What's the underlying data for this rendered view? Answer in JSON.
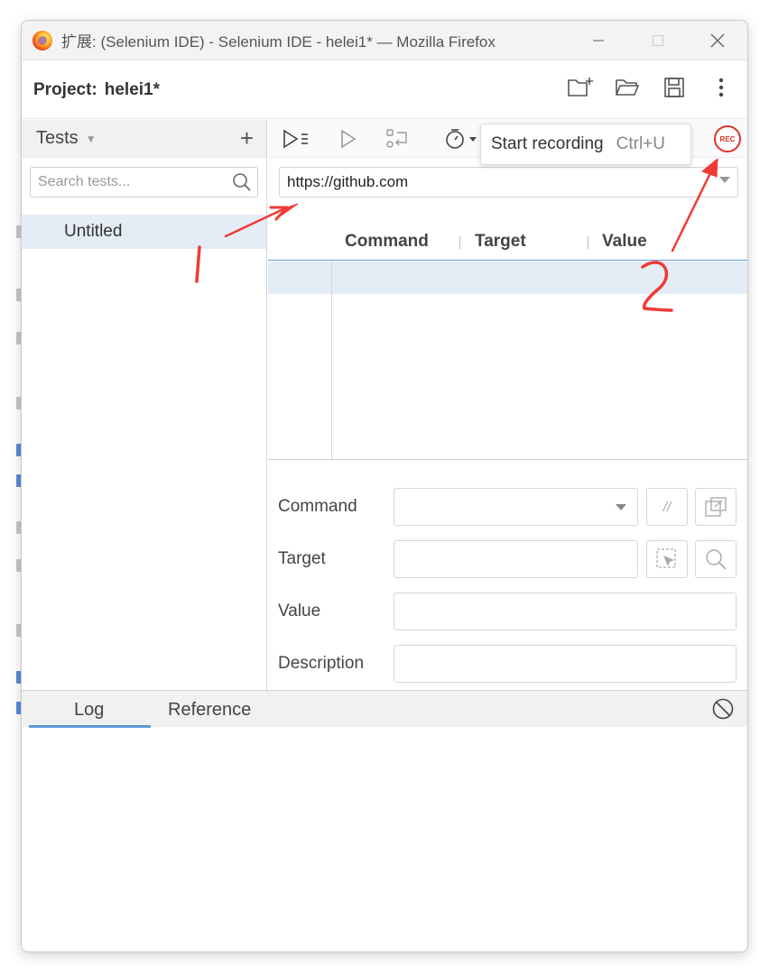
{
  "window": {
    "title": "扩展: (Selenium IDE) - Selenium IDE - helei1* — Mozilla Firefox",
    "controls": [
      "—",
      "☐",
      "✕"
    ]
  },
  "project": {
    "label": "Project:",
    "name": "helei1*",
    "actions": [
      "new-project-icon",
      "open-project-icon",
      "save-project-icon",
      "more-options-icon"
    ]
  },
  "tests_panel": {
    "title": "Tests",
    "add_label": "+",
    "search_placeholder": "Search tests...",
    "items": [
      {
        "label": "Untitled",
        "selected": true
      }
    ]
  },
  "toolbar": {
    "tooltip": {
      "text": "Start recording",
      "shortcut": "Ctrl+U"
    },
    "rec_label": "REC",
    "icons": [
      "run-all-tests-icon",
      "run-current-test-icon",
      "step-over-icon",
      "speed-icon",
      "record-icon"
    ]
  },
  "url": {
    "value": "https://github.com"
  },
  "command_table": {
    "columns": [
      "Command",
      "Target",
      "Value"
    ],
    "rows": []
  },
  "command_form": {
    "command_label": "Command",
    "target_label": "Target",
    "value_label": "Value",
    "description_label": "Description",
    "command_value": "",
    "target_value": "",
    "value_value": "",
    "description_value": "",
    "comment_glyph": "//"
  },
  "log_panel": {
    "tabs": [
      "Log",
      "Reference"
    ],
    "active_tab": "Log"
  },
  "annotations": {
    "mark1": "1",
    "mark2": "2",
    "color": "#ef3b36"
  },
  "colors": {
    "accent": "#5b9bd5",
    "selection": "#e4ecf5",
    "record": "#d9342b"
  }
}
